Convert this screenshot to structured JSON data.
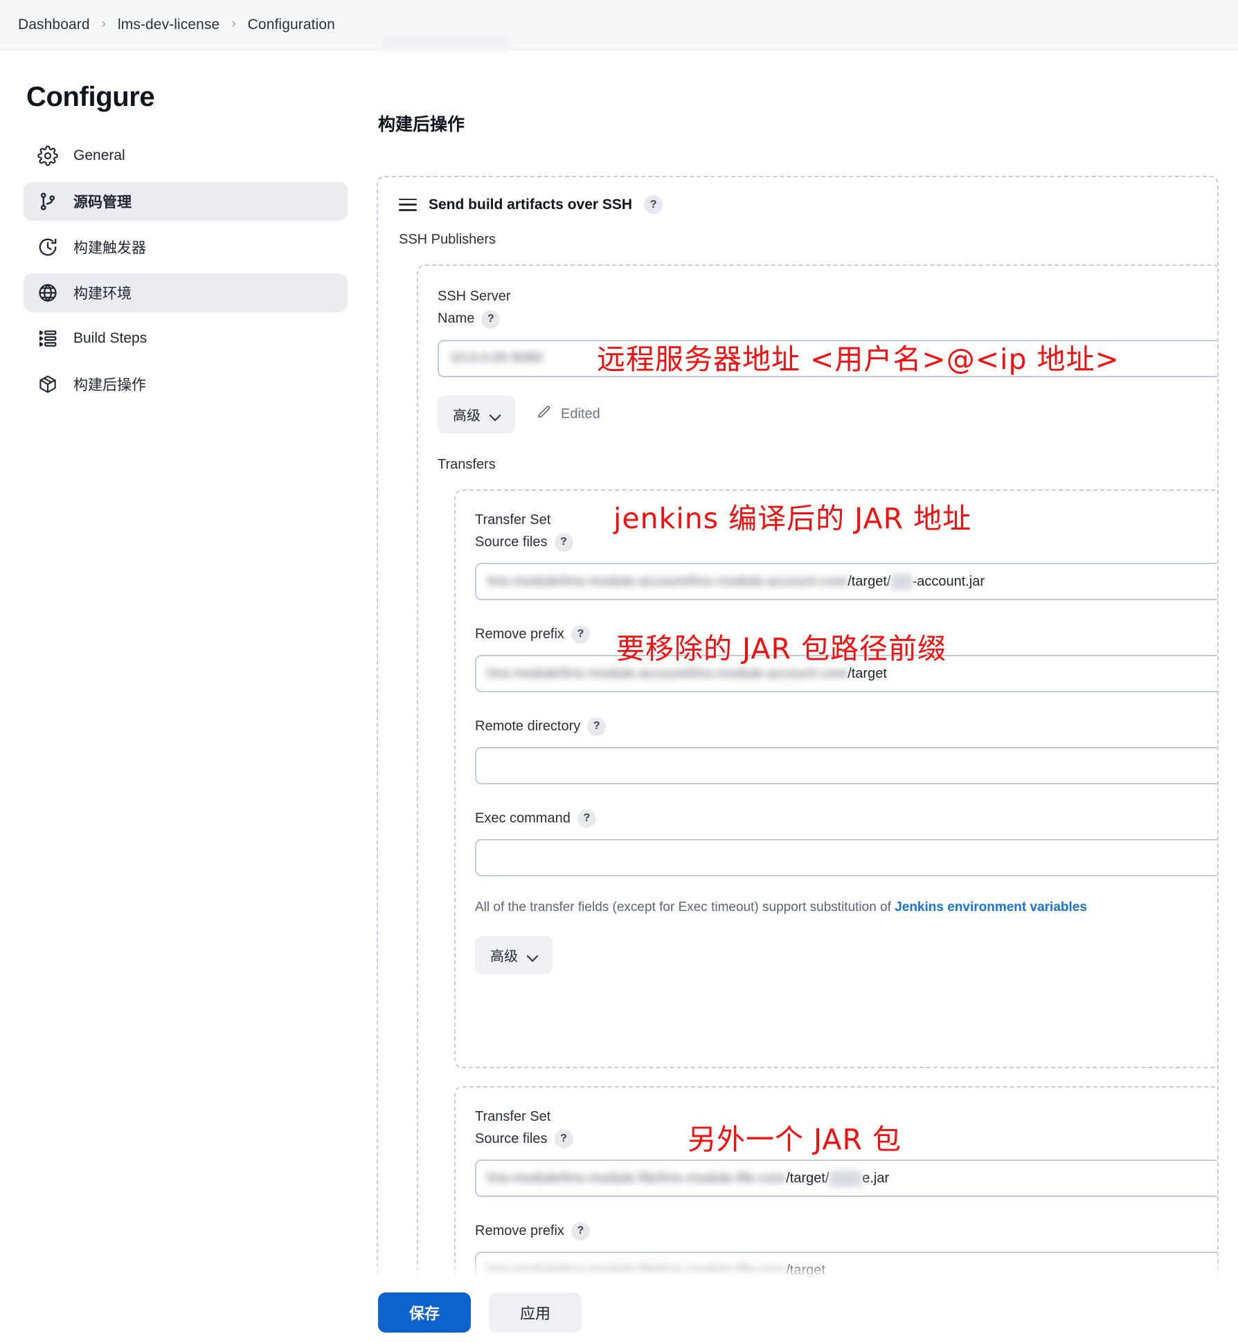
{
  "breadcrumb": {
    "items": [
      "Dashboard",
      "lms-dev-license",
      "Configuration"
    ],
    "separator": "›"
  },
  "sidebar": {
    "title": "Configure",
    "items": [
      {
        "label": "General",
        "icon": "gear-icon",
        "state": "normal"
      },
      {
        "label": "源码管理",
        "icon": "git-branch-icon",
        "state": "active-bold"
      },
      {
        "label": "构建触发器",
        "icon": "clock-icon",
        "state": "normal"
      },
      {
        "label": "构建环境",
        "icon": "globe-icon",
        "state": "active"
      },
      {
        "label": "Build Steps",
        "icon": "list-steps-icon",
        "state": "normal"
      },
      {
        "label": "构建后操作",
        "icon": "package-icon",
        "state": "normal"
      }
    ]
  },
  "main": {
    "section_title": "构建后操作",
    "panel": {
      "title": "Send build artifacts over SSH",
      "help": "?",
      "publishers_label": "SSH Publishers",
      "ssh_server": {
        "label_line1": "SSH Server",
        "label_line2": "Name",
        "help": "?",
        "value_blurred": "10.0.0.00 8080",
        "advanced_label": "高级",
        "edited_label": "Edited"
      },
      "transfers_label": "Transfers",
      "transfer_sets": [
        {
          "title_line1": "Transfer Set",
          "title_line2": "Source files",
          "help": "?",
          "source_files": {
            "blurred_prefix": "lms-module/lms-module-account/lms-module-account-core",
            "visible_middle": "/target/",
            "blurred_mid": "lms",
            "visible_suffix": "-account.jar"
          },
          "remove_prefix": {
            "label": "Remove prefix",
            "help": "?",
            "blurred_prefix": "lms-module/lms-module-account/lms-module-account-core",
            "visible_suffix": "/target"
          },
          "remote_directory": {
            "label": "Remote directory",
            "help": "?",
            "value": ""
          },
          "exec_command": {
            "label": "Exec command",
            "help": "?",
            "value": ""
          },
          "note_text": "All of the transfer fields (except for Exec timeout) support substitution of ",
          "note_link": "Jenkins environment variables",
          "advanced_label": "高级"
        },
        {
          "title_line1": "Transfer Set",
          "title_line2": "Source files",
          "help": "?",
          "source_files": {
            "blurred_prefix": "lms-module/lms-module-file/lms-module-file-core",
            "visible_middle": "/target/",
            "blurred_mid": "lms-fi",
            "visible_suffix": "e.jar"
          },
          "remove_prefix": {
            "label": "Remove prefix",
            "help": "?",
            "blurred_prefix": "lms-module/lms-module-file/lms-module-file-core",
            "visible_suffix": "/target"
          }
        }
      ]
    },
    "annotations": [
      {
        "text": "远程服务器地址 <用户名>@<ip 地址>"
      },
      {
        "text": "jenkins 编译后的 JAR 地址"
      },
      {
        "text": "要移除的 JAR 包路径前缀"
      },
      {
        "text": "另外一个 JAR 包"
      }
    ]
  },
  "footer": {
    "save_label": "保存",
    "apply_label": "应用"
  },
  "colors": {
    "primary": "#0d62cc",
    "annotation_red": "#f01010",
    "link_blue": "#1a73d0",
    "active_nav_bg": "#eaecf1"
  }
}
